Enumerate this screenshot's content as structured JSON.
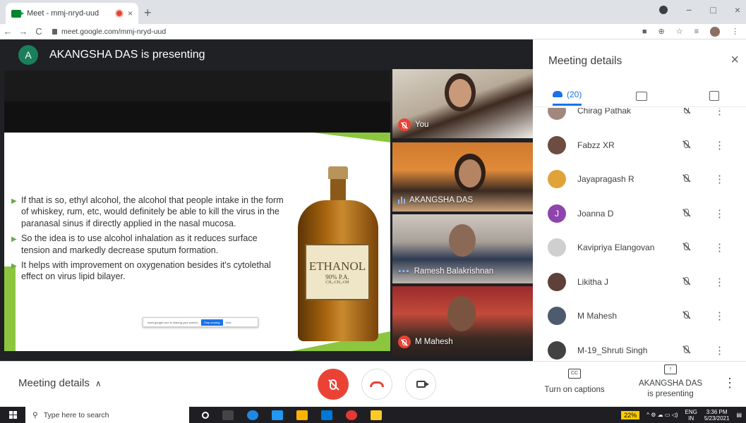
{
  "browser": {
    "tab_title": "Meet - mmj-nryd-uud",
    "tab_close": "×",
    "new_tab": "+",
    "url": "meet.google.com/mmj-nryd-uud",
    "back": "←",
    "forward": "→",
    "reload": "C",
    "win_minimize": "−",
    "win_maximize": "□",
    "win_close": "×"
  },
  "presenter": {
    "avatar_letter": "A",
    "text": "AKANGSHA DAS is presenting"
  },
  "slide": {
    "bullets": [
      "If that is so, ethyl alcohol, the alcohol that people intake in the form of whiskey, rum, etc, would definitely be able to kill the virus in the paranasal sinus if directly applied in the nasal mucosa.",
      "So the idea is to use alcohol inhalation as it reduces surface tension and markedly decrease sputum formation.",
      "It helps with improvement on oxygenation besides it's cytolethal effect on virus lipid bilayer."
    ],
    "bottle_label": "ETHANOL",
    "bottle_sub": "90% P.A.",
    "bottle_formula": "CH₃-CH₂-OH",
    "sharebar_text": "meet.google.com is sharing your screen.",
    "sharebar_stop": "Stop sharing",
    "sharebar_hide": "Hide"
  },
  "tiles": [
    {
      "name": "You",
      "status": "muted"
    },
    {
      "name": "AKANGSHA DAS",
      "status": "speaking"
    },
    {
      "name": "Ramesh Balakrishnan",
      "status": "idle"
    },
    {
      "name": "M Mahesh",
      "status": "muted"
    }
  ],
  "controls": {
    "meeting_details": "Meeting details",
    "captions_label": "Turn on captions",
    "captions_icon": "CC",
    "presenting_line1": "AKANGSHA DAS",
    "presenting_line2": "is presenting",
    "more": "⋮",
    "chevron": "∧"
  },
  "panel": {
    "title": "Meeting details",
    "close": "×",
    "people_count": "(20)",
    "participants": [
      {
        "name": "Chirag Pathak",
        "avatar_color": "#a1887f",
        "initial": ""
      },
      {
        "name": "Fabzz XR",
        "avatar_color": "#6d4c41",
        "initial": ""
      },
      {
        "name": "Jayapragash R",
        "avatar_color": "#e0a33a",
        "initial": ""
      },
      {
        "name": "Joanna D",
        "avatar_color": "#8e44ad",
        "initial": "J"
      },
      {
        "name": "Kavipriya Elangovan",
        "avatar_color": "#cfcfcf",
        "initial": ""
      },
      {
        "name": "Likitha J",
        "avatar_color": "#5d4037",
        "initial": ""
      },
      {
        "name": "M Mahesh",
        "avatar_color": "#4e5b6e",
        "initial": ""
      },
      {
        "name": "M-19_Shruti Singh",
        "avatar_color": "#424242",
        "initial": ""
      }
    ]
  },
  "taskbar": {
    "search_placeholder": "Type here to search",
    "battery": "22%",
    "lang_top": "ENG",
    "lang_bottom": "IN",
    "time": "3:36 PM",
    "date": "5/23/2021"
  }
}
